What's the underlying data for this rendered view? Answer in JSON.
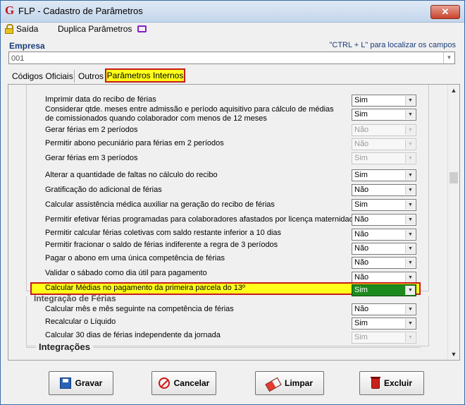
{
  "window": {
    "title": "FLP - Cadastro de Parâmetros",
    "close_label": "✕"
  },
  "menu": {
    "exit_label": "Saída",
    "duplicate_label": "Duplica Parâmetros"
  },
  "empresa": {
    "label": "Empresa",
    "hint": "\"CTRL + L\" para localizar os campos",
    "value": "001"
  },
  "tabs": [
    {
      "label": "Códigos Oficiais",
      "active": false
    },
    {
      "label": "Outros",
      "active": false
    },
    {
      "label": "Parâmetros Internos",
      "active": true
    }
  ],
  "rows": [
    {
      "label": "Imprimir data do recibo de férias",
      "value": "Sim",
      "enabled": true
    },
    {
      "label": "Considerar qtde. meses entre admissão e período aquisitivo para cálculo de médias de comissionados quando colaborador com menos de 12 meses",
      "value": "Sim",
      "enabled": true
    },
    {
      "label": "Gerar férias em 2 períodos",
      "value": "Não",
      "enabled": false
    },
    {
      "label": "Permitir abono pecuniário para férias em 2 períodos",
      "value": "Não",
      "enabled": false
    },
    {
      "label": "Gerar férias em 3 períodos",
      "value": "Sim",
      "enabled": false
    },
    {
      "label": "Alterar a quantidade de faltas no cálculo do recibo",
      "value": "Sim",
      "enabled": true
    },
    {
      "label": "Gratificação do adicional de férias",
      "value": "Não",
      "enabled": true
    },
    {
      "label": "Calcular assistência médica auxiliar na geração do recibo de férias",
      "value": "Sim",
      "enabled": true
    },
    {
      "label": "Permitir efetivar férias programadas para colaboradores afastados por licença maternidade",
      "value": "Não",
      "enabled": true
    },
    {
      "label": "Permitir calcular férias coletivas com saldo restante inferior a 10 dias",
      "value": "Não",
      "enabled": true
    },
    {
      "label": "Permitir fracionar o saldo de férias indiferente a regra de 3 períodos",
      "value": "Não",
      "enabled": true
    },
    {
      "label": "Pagar o abono em uma única competência de férias",
      "value": "Não",
      "enabled": true
    },
    {
      "label": "Validar o sábado como dia útil para pagamento",
      "value": "Não",
      "enabled": true
    },
    {
      "label": "Calcular Médias no pagamento da primeira parcela do 13º",
      "value": "Sim",
      "enabled": true
    }
  ],
  "section_integracao": {
    "title": "Integração de Férias",
    "rows": [
      {
        "label": "Calcular mês e mês seguinte na competência de férias",
        "value": "Não",
        "enabled": true
      },
      {
        "label": "Recalcular o Líquido",
        "value": "Sim",
        "enabled": true
      },
      {
        "label": "Calcular 30 dias de férias independente da jornada",
        "value": "Sim",
        "enabled": false
      }
    ]
  },
  "section_integracoes": {
    "title": "Integrações"
  },
  "buttons": {
    "save": "Gravar",
    "cancel": "Cancelar",
    "clear": "Limpar",
    "delete": "Excluir"
  },
  "colors": {
    "highlight": "#ffff1a",
    "highlight_border": "#c71a1a",
    "selected_dropdown": "#1e8a1e"
  }
}
